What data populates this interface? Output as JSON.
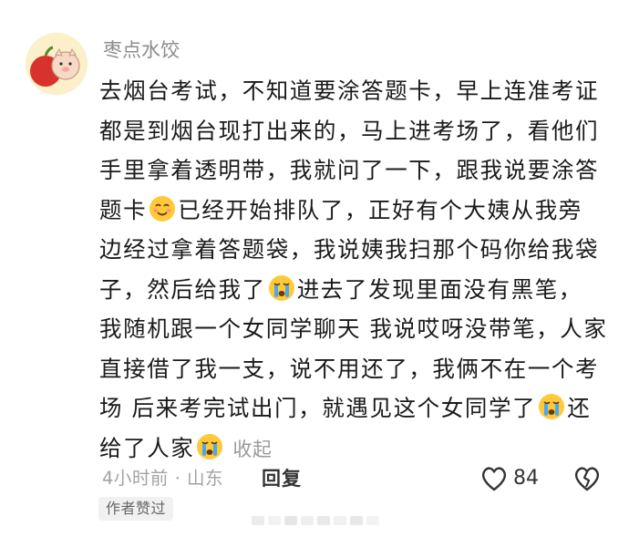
{
  "comment": {
    "username": "枣点水饺",
    "lines": [
      "去烟台考试，不知道要涂答题卡，早上连准考证",
      "都是到烟台现打出来的，马上进考场了，看他们",
      "手里拿着透明带，我就问了一下，跟我说要涂答"
    ],
    "line4_a": "题卡",
    "line4_b": "已经开始排队了，正好有个大姨从我旁",
    "line5": "边经过拿着答题袋，我说姨我扫那个码你给我袋",
    "line6_a": "子，然后给我了",
    "line6_b": "进去了发现里面没有黑笔，",
    "line7": "我随机跟一个女同学聊天 我说哎呀没带笔，人家",
    "line8": "直接借了我一支，说不用还了，我俩不在一个考",
    "line9_a": "场 后来考完试出门，就遇见这个女同学了",
    "line9_b": "还",
    "line10_a": "给了人家",
    "collapse_label": "收起",
    "emojis": [
      "smile-emoji",
      "crying-emoji",
      "crying-emoji",
      "crying-emoji"
    ]
  },
  "meta": {
    "time_location": "4小时前 · 山东",
    "reply_label": "回复",
    "like_count": "84",
    "badge": "作者赞过"
  }
}
